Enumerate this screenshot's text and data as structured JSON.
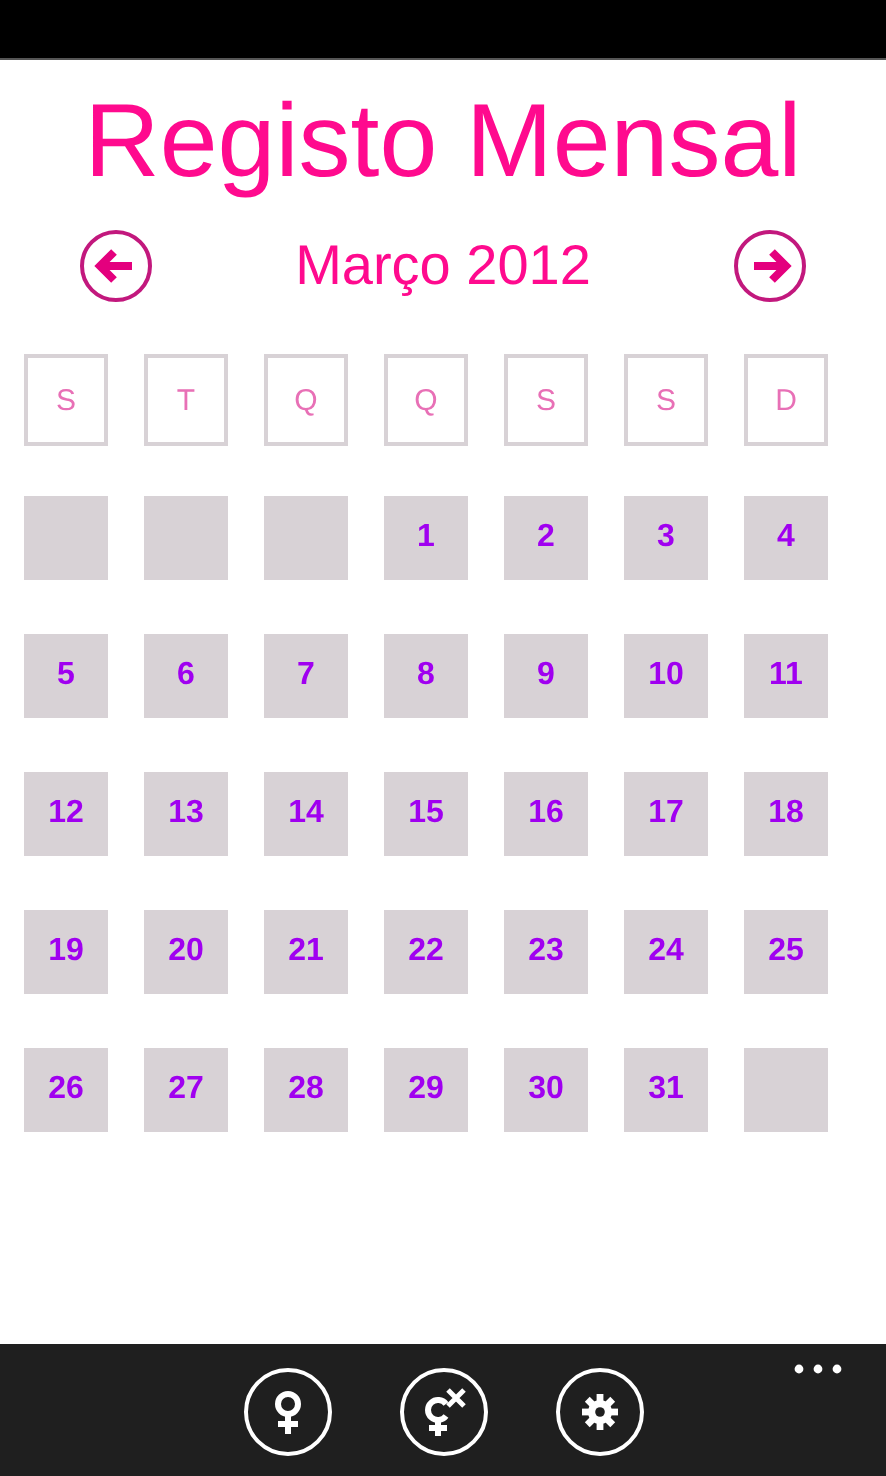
{
  "title": "Registo Mensal",
  "month": {
    "label": "Março 2012"
  },
  "weekdays": [
    "S",
    "T",
    "Q",
    "Q",
    "S",
    "S",
    "D"
  ],
  "weeks": [
    [
      {
        "kind": "blank"
      },
      {
        "kind": "blank"
      },
      {
        "kind": "blank"
      },
      {
        "kind": "day",
        "day": "1"
      },
      {
        "kind": "day",
        "day": "2"
      },
      {
        "kind": "day",
        "day": "3"
      },
      {
        "kind": "day",
        "day": "4"
      }
    ],
    [
      {
        "kind": "day",
        "day": "5"
      },
      {
        "kind": "day",
        "day": "6"
      },
      {
        "kind": "day",
        "day": "7"
      },
      {
        "kind": "day",
        "day": "8"
      },
      {
        "kind": "day",
        "day": "9"
      },
      {
        "kind": "day",
        "day": "10"
      },
      {
        "kind": "day",
        "day": "11"
      }
    ],
    [
      {
        "kind": "day",
        "day": "12"
      },
      {
        "kind": "day",
        "day": "13"
      },
      {
        "kind": "day",
        "day": "14"
      },
      {
        "kind": "day",
        "day": "15"
      },
      {
        "kind": "day",
        "day": "16"
      },
      {
        "kind": "day",
        "day": "17"
      },
      {
        "kind": "day",
        "day": "18"
      }
    ],
    [
      {
        "kind": "day",
        "day": "19"
      },
      {
        "kind": "day",
        "day": "20"
      },
      {
        "kind": "day",
        "day": "21"
      },
      {
        "kind": "day",
        "day": "22"
      },
      {
        "kind": "day",
        "day": "23"
      },
      {
        "kind": "day",
        "day": "24"
      },
      {
        "kind": "day",
        "day": "25"
      }
    ],
    [
      {
        "kind": "day",
        "day": "26"
      },
      {
        "kind": "day",
        "day": "27"
      },
      {
        "kind": "day",
        "day": "28"
      },
      {
        "kind": "day",
        "day": "29"
      },
      {
        "kind": "day",
        "day": "30"
      },
      {
        "kind": "day",
        "day": "31"
      },
      {
        "kind": "blank"
      }
    ]
  ],
  "app_bar": {
    "buttons": [
      {
        "kind": "female"
      },
      {
        "kind": "female-cancel"
      },
      {
        "kind": "settings"
      }
    ]
  }
}
